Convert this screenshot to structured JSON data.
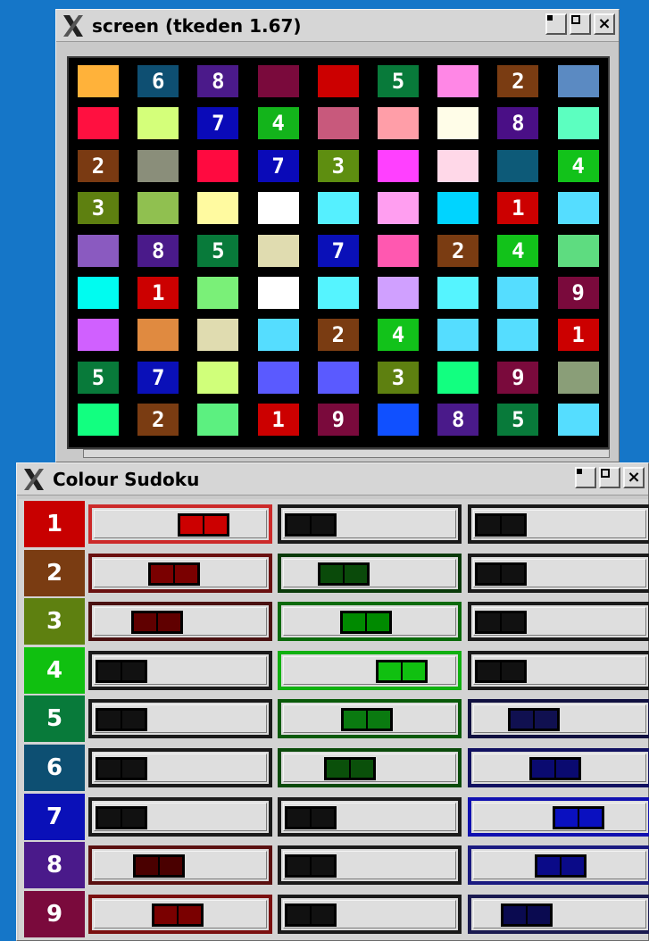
{
  "screen_window": {
    "title": "screen (tkeden 1.67)",
    "cells": [
      [
        {
          "c": "#ffb23a",
          "t": ""
        },
        {
          "c": "#0e4f72",
          "t": "6"
        },
        {
          "c": "#4b1a8a",
          "t": "8"
        },
        {
          "c": "#7a0a3c",
          "t": ""
        },
        {
          "c": "#cc0000",
          "t": ""
        },
        {
          "c": "#087a3a",
          "t": "5"
        },
        {
          "c": "#ff87e6",
          "t": ""
        },
        {
          "c": "#7a3c12",
          "t": "2"
        },
        {
          "c": "#5b8ac2",
          "t": ""
        }
      ],
      [
        {
          "c": "#ff1040",
          "t": ""
        },
        {
          "c": "#d4ff7a",
          "t": ""
        },
        {
          "c": "#0a0ab8",
          "t": "7"
        },
        {
          "c": "#13b41b",
          "t": "4"
        },
        {
          "c": "#c8597c",
          "t": ""
        },
        {
          "c": "#ff9ea8",
          "t": ""
        },
        {
          "c": "#fffde8",
          "t": ""
        },
        {
          "c": "#4a0f86",
          "t": "8"
        },
        {
          "c": "#5cffc0",
          "t": ""
        }
      ],
      [
        {
          "c": "#7a3a12",
          "t": "2"
        },
        {
          "c": "#8a8e7a",
          "t": ""
        },
        {
          "c": "#ff0a40",
          "t": ""
        },
        {
          "c": "#0a0ab8",
          "t": "7"
        },
        {
          "c": "#5e8e10",
          "t": "3"
        },
        {
          "c": "#ff40ff",
          "t": ""
        },
        {
          "c": "#ffd8e8",
          "t": ""
        },
        {
          "c": "#0d5a78",
          "t": ""
        },
        {
          "c": "#12c21a",
          "t": "4"
        }
      ],
      [
        {
          "c": "#5e8010",
          "t": "3"
        },
        {
          "c": "#90c050",
          "t": ""
        },
        {
          "c": "#fffaa0",
          "t": ""
        },
        {
          "c": "#ffffff",
          "t": ""
        },
        {
          "c": "#55f0ff",
          "t": ""
        },
        {
          "c": "#ff9ef0",
          "t": ""
        },
        {
          "c": "#00d4ff",
          "t": ""
        },
        {
          "c": "#cc0000",
          "t": "1"
        },
        {
          "c": "#55ddff",
          "t": ""
        }
      ],
      [
        {
          "c": "#8a5ac0",
          "t": ""
        },
        {
          "c": "#4a1a8a",
          "t": "8"
        },
        {
          "c": "#087a3a",
          "t": "5"
        },
        {
          "c": "#e0dcb0",
          "t": ""
        },
        {
          "c": "#0a10b8",
          "t": "7"
        },
        {
          "c": "#ff58b0",
          "t": ""
        },
        {
          "c": "#7a3c12",
          "t": "2"
        },
        {
          "c": "#12c21a",
          "t": "4"
        },
        {
          "c": "#5edc80",
          "t": ""
        }
      ],
      [
        {
          "c": "#00fcf0",
          "t": ""
        },
        {
          "c": "#cc0000",
          "t": "1"
        },
        {
          "c": "#7af078",
          "t": ""
        },
        {
          "c": "#ffffff",
          "t": ""
        },
        {
          "c": "#55f4ff",
          "t": ""
        },
        {
          "c": "#d0a0ff",
          "t": ""
        },
        {
          "c": "#55f4ff",
          "t": ""
        },
        {
          "c": "#55ddff",
          "t": ""
        },
        {
          "c": "#7a0a3c",
          "t": "9"
        }
      ],
      [
        {
          "c": "#d060ff",
          "t": ""
        },
        {
          "c": "#e08a40",
          "t": ""
        },
        {
          "c": "#e0dcb0",
          "t": ""
        },
        {
          "c": "#55ddff",
          "t": ""
        },
        {
          "c": "#7a3c12",
          "t": "2"
        },
        {
          "c": "#12c21a",
          "t": "4"
        },
        {
          "c": "#55ddff",
          "t": ""
        },
        {
          "c": "#55ddff",
          "t": ""
        },
        {
          "c": "#cc0000",
          "t": "1"
        }
      ],
      [
        {
          "c": "#087a3a",
          "t": "5"
        },
        {
          "c": "#0a10b8",
          "t": "7"
        },
        {
          "c": "#d0ff7a",
          "t": ""
        },
        {
          "c": "#5a5aff",
          "t": ""
        },
        {
          "c": "#5a5aff",
          "t": ""
        },
        {
          "c": "#5e8010",
          "t": "3"
        },
        {
          "c": "#12ff80",
          "t": ""
        },
        {
          "c": "#7a0a3c",
          "t": "9"
        },
        {
          "c": "#8a9e78",
          "t": ""
        }
      ],
      [
        {
          "c": "#12ff80",
          "t": ""
        },
        {
          "c": "#7a3c12",
          "t": "2"
        },
        {
          "c": "#5cf080",
          "t": ""
        },
        {
          "c": "#cc0000",
          "t": "1"
        },
        {
          "c": "#7a0a3c",
          "t": "9"
        },
        {
          "c": "#1050ff",
          "t": ""
        },
        {
          "c": "#4a1a8a",
          "t": "8"
        },
        {
          "c": "#087a3a",
          "t": "5"
        },
        {
          "c": "#55ddff",
          "t": ""
        }
      ]
    ]
  },
  "sudoku_window": {
    "title": "Colour Sudoku",
    "rows": [
      {
        "label": "1",
        "color": "#c80000",
        "sliders": [
          {
            "level": 0.7,
            "color": "#cc0000",
            "frame": "#cc2a2a"
          },
          {
            "level": 0,
            "color": "#111111",
            "frame": "#1a1a1a"
          },
          {
            "level": 0,
            "color": "#111111",
            "frame": "#1a1a1a"
          }
        ]
      },
      {
        "label": "2",
        "color": "#7a3c12",
        "sliders": [
          {
            "level": 0.45,
            "color": "#7a0000",
            "frame": "#6a1010"
          },
          {
            "level": 0.28,
            "color": "#0a4a0a",
            "frame": "#0a3a0a"
          },
          {
            "level": 0,
            "color": "#111111",
            "frame": "#1a1a1a"
          }
        ]
      },
      {
        "label": "3",
        "color": "#5e8010",
        "sliders": [
          {
            "level": 0.3,
            "color": "#600000",
            "frame": "#4a1010"
          },
          {
            "level": 0.47,
            "color": "#008a00",
            "frame": "#0a6a0a"
          },
          {
            "level": 0,
            "color": "#111111",
            "frame": "#1a1a1a"
          }
        ]
      },
      {
        "label": "4",
        "color": "#10c010",
        "sliders": [
          {
            "level": 0,
            "color": "#111111",
            "frame": "#1a1a1a"
          },
          {
            "level": 0.77,
            "color": "#10c010",
            "frame": "#10b010"
          },
          {
            "level": 0,
            "color": "#111111",
            "frame": "#1a1a1a"
          }
        ]
      },
      {
        "label": "5",
        "color": "#087a3a",
        "sliders": [
          {
            "level": 0,
            "color": "#111111",
            "frame": "#1a1a1a"
          },
          {
            "level": 0.48,
            "color": "#0a7a10",
            "frame": "#0a5a0a"
          },
          {
            "level": 0.28,
            "color": "#101050",
            "frame": "#101040"
          }
        ]
      },
      {
        "label": "6",
        "color": "#0d4f72",
        "sliders": [
          {
            "level": 0,
            "color": "#111111",
            "frame": "#1a1a1a"
          },
          {
            "level": 0.33,
            "color": "#0a500a",
            "frame": "#0a4a0a"
          },
          {
            "level": 0.46,
            "color": "#0a0a70",
            "frame": "#101060"
          }
        ]
      },
      {
        "label": "7",
        "color": "#0a10b8",
        "sliders": [
          {
            "level": 0,
            "color": "#111111",
            "frame": "#1a1a1a"
          },
          {
            "level": 0,
            "color": "#111111",
            "frame": "#1a1a1a"
          },
          {
            "level": 0.66,
            "color": "#0a10c0",
            "frame": "#1010b0"
          }
        ]
      },
      {
        "label": "8",
        "color": "#4a1a8a",
        "sliders": [
          {
            "level": 0.32,
            "color": "#4a0000",
            "frame": "#5a1010"
          },
          {
            "level": 0,
            "color": "#111111",
            "frame": "#1a1a1a"
          },
          {
            "level": 0.51,
            "color": "#0a0a88",
            "frame": "#1a1a80"
          }
        ]
      },
      {
        "label": "9",
        "color": "#7a0a3c",
        "sliders": [
          {
            "level": 0.48,
            "color": "#7a0000",
            "frame": "#7a1010"
          },
          {
            "level": 0,
            "color": "#111111",
            "frame": "#1a1a1a"
          },
          {
            "level": 0.22,
            "color": "#0a0a50",
            "frame": "#1a1a50"
          }
        ]
      }
    ]
  }
}
